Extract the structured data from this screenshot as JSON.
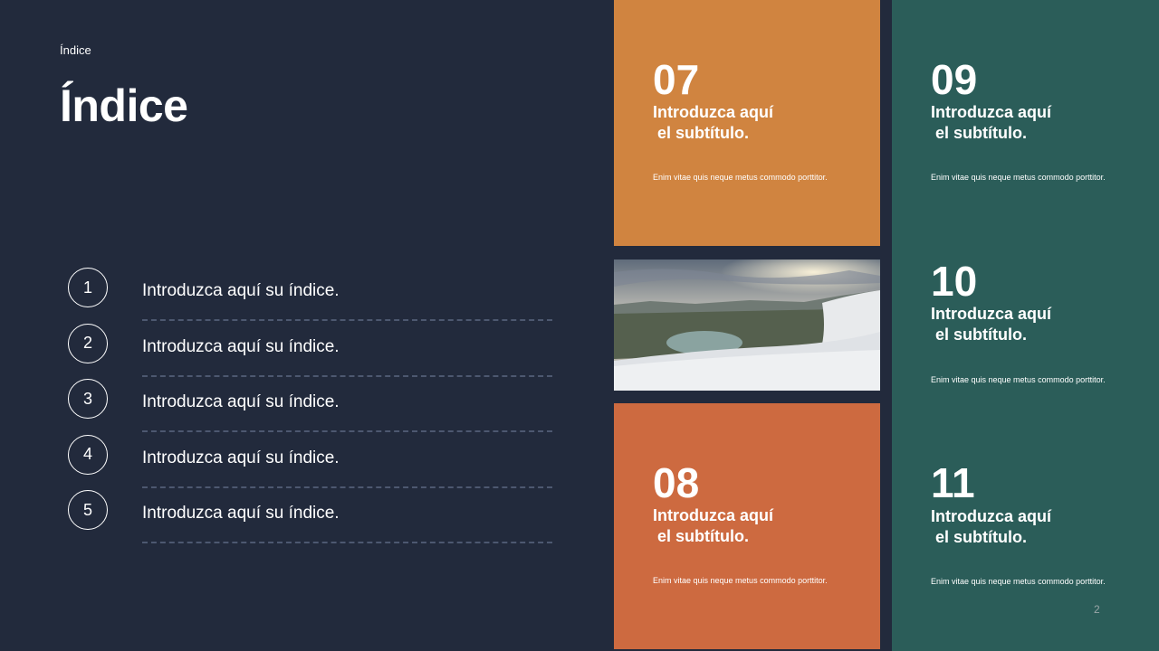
{
  "header": {
    "breadcrumb": "Índice",
    "title": "Índice"
  },
  "toc": {
    "items": [
      {
        "num": "1",
        "label": "Introduzca aquí su índice."
      },
      {
        "num": "2",
        "label": "Introduzca aquí su índice."
      },
      {
        "num": "3",
        "label": "Introduzca aquí su índice."
      },
      {
        "num": "4",
        "label": "Introduzca aquí su índice."
      },
      {
        "num": "5",
        "label": "Introduzca aquí su índice."
      }
    ]
  },
  "cards": {
    "c07": {
      "num": "07",
      "subtitle": "Introduzca aquí\n el subtítulo.",
      "body": "Enim vitae quis neque metus commodo porttitor.",
      "color": "#d08440"
    },
    "c08": {
      "num": "08",
      "subtitle": "Introduzca aquí\n el subtítulo.",
      "body": "Enim vitae quis neque metus commodo porttitor.",
      "color": "#cd6a40"
    },
    "c09": {
      "num": "09",
      "subtitle": "Introduzca aquí\n el subtítulo.",
      "body": "Enim vitae quis neque metus commodo porttitor."
    },
    "c10": {
      "num": "10",
      "subtitle": "Introduzca aquí\n el subtítulo.",
      "body": "Enim vitae quis neque metus commodo porttitor."
    },
    "c11": {
      "num": "11",
      "subtitle": "Introduzca aquí\n el subtítulo.",
      "body": "Enim vitae quis neque metus commodo porttitor."
    },
    "teal_color": "#2b5d59"
  },
  "page_number": "2",
  "colors": {
    "background": "#222a3c",
    "text": "#ffffff"
  }
}
